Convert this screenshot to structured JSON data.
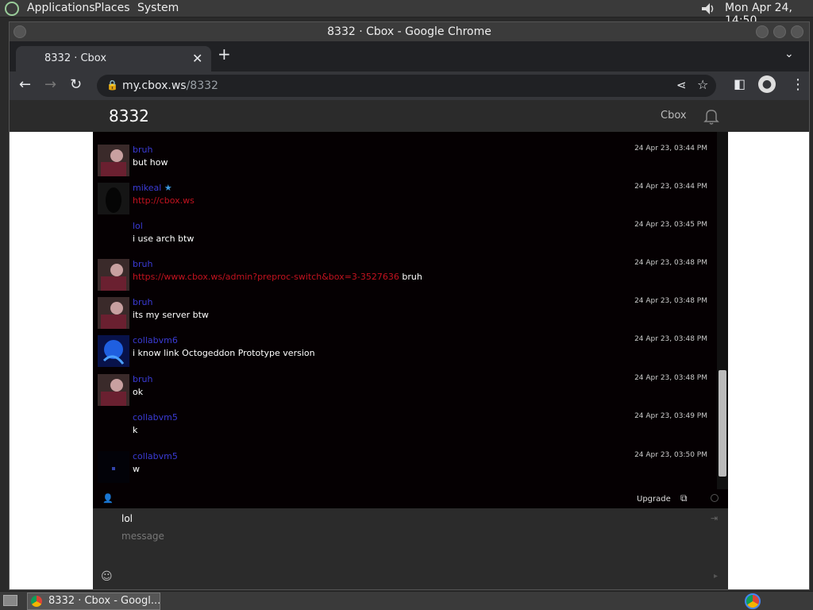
{
  "top_panel": {
    "menu": [
      "Applications",
      "Places",
      "System"
    ],
    "clock": "Mon Apr 24, 14:50"
  },
  "window": {
    "title": "8332 · Cbox - Google Chrome"
  },
  "browser": {
    "tab_title": "8332 · Cbox",
    "url_host": "my.cbox.ws",
    "url_path": "/8332"
  },
  "site": {
    "room_title": "8332",
    "cbox_label": "Cbox"
  },
  "messages": [
    {
      "user": "bruh",
      "text": "but how",
      "link": "",
      "time": "24 Apr 23, 03:44 PM"
    },
    {
      "user": "mikeal",
      "text": "",
      "link": "http://cbox.ws",
      "time": "24 Apr 23, 03:44 PM"
    },
    {
      "user": "lol",
      "text": "i use arch btw",
      "link": "",
      "time": "24 Apr 23, 03:45 PM"
    },
    {
      "user": "bruh",
      "text": "bruh",
      "link": "https://www.cbox.ws/admin?preproc-switch&box=3-3527636",
      "time": "24 Apr 23, 03:48 PM"
    },
    {
      "user": "bruh",
      "text": "its my server btw",
      "link": "",
      "time": "24 Apr 23, 03:48 PM"
    },
    {
      "user": "collabvm6",
      "text": "i know link Octogeddon Prototype version",
      "link": "",
      "time": "24 Apr 23, 03:48 PM"
    },
    {
      "user": "bruh",
      "text": "ok",
      "link": "",
      "time": "24 Apr 23, 03:48 PM"
    },
    {
      "user": "collabvm5",
      "text": "k",
      "link": "",
      "time": "24 Apr 23, 03:49 PM"
    },
    {
      "user": "collabvm5",
      "text": "w",
      "link": "",
      "time": "24 Apr 23, 03:50 PM"
    }
  ],
  "chat_footer": {
    "upgrade_label": "Upgrade"
  },
  "input": {
    "name_value": "lol",
    "message_placeholder": "message"
  },
  "taskbar": {
    "task_label": "8332 · Cbox - Googl..."
  }
}
